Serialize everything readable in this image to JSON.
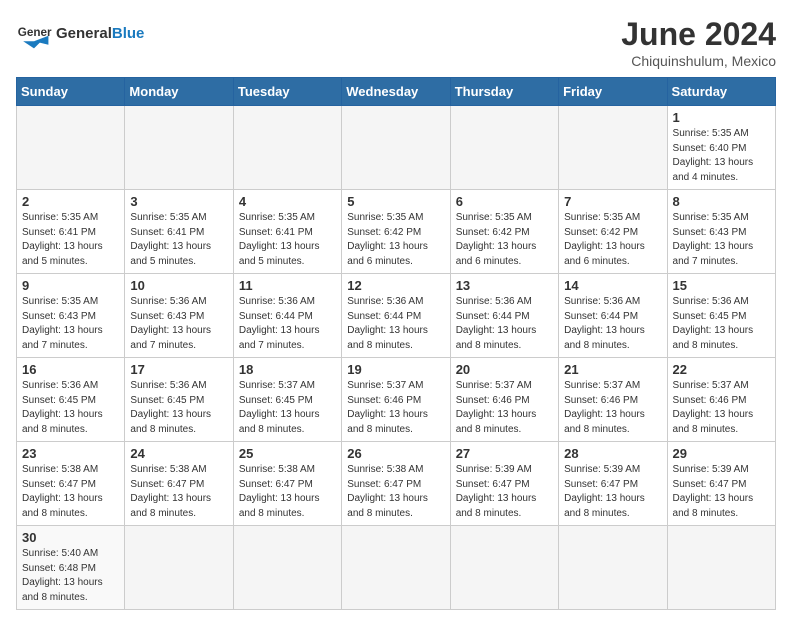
{
  "header": {
    "logo_general": "General",
    "logo_blue": "Blue",
    "month_year": "June 2024",
    "location": "Chiquinshulum, Mexico"
  },
  "days_of_week": [
    "Sunday",
    "Monday",
    "Tuesday",
    "Wednesday",
    "Thursday",
    "Friday",
    "Saturday"
  ],
  "weeks": [
    [
      {
        "day": "",
        "info": ""
      },
      {
        "day": "",
        "info": ""
      },
      {
        "day": "",
        "info": ""
      },
      {
        "day": "",
        "info": ""
      },
      {
        "day": "",
        "info": ""
      },
      {
        "day": "",
        "info": ""
      },
      {
        "day": "1",
        "info": "Sunrise: 5:35 AM\nSunset: 6:40 PM\nDaylight: 13 hours\nand 4 minutes."
      }
    ],
    [
      {
        "day": "2",
        "info": "Sunrise: 5:35 AM\nSunset: 6:41 PM\nDaylight: 13 hours\nand 5 minutes."
      },
      {
        "day": "3",
        "info": "Sunrise: 5:35 AM\nSunset: 6:41 PM\nDaylight: 13 hours\nand 5 minutes."
      },
      {
        "day": "4",
        "info": "Sunrise: 5:35 AM\nSunset: 6:41 PM\nDaylight: 13 hours\nand 5 minutes."
      },
      {
        "day": "5",
        "info": "Sunrise: 5:35 AM\nSunset: 6:42 PM\nDaylight: 13 hours\nand 6 minutes."
      },
      {
        "day": "6",
        "info": "Sunrise: 5:35 AM\nSunset: 6:42 PM\nDaylight: 13 hours\nand 6 minutes."
      },
      {
        "day": "7",
        "info": "Sunrise: 5:35 AM\nSunset: 6:42 PM\nDaylight: 13 hours\nand 6 minutes."
      },
      {
        "day": "8",
        "info": "Sunrise: 5:35 AM\nSunset: 6:43 PM\nDaylight: 13 hours\nand 7 minutes."
      }
    ],
    [
      {
        "day": "9",
        "info": "Sunrise: 5:35 AM\nSunset: 6:43 PM\nDaylight: 13 hours\nand 7 minutes."
      },
      {
        "day": "10",
        "info": "Sunrise: 5:36 AM\nSunset: 6:43 PM\nDaylight: 13 hours\nand 7 minutes."
      },
      {
        "day": "11",
        "info": "Sunrise: 5:36 AM\nSunset: 6:44 PM\nDaylight: 13 hours\nand 7 minutes."
      },
      {
        "day": "12",
        "info": "Sunrise: 5:36 AM\nSunset: 6:44 PM\nDaylight: 13 hours\nand 8 minutes."
      },
      {
        "day": "13",
        "info": "Sunrise: 5:36 AM\nSunset: 6:44 PM\nDaylight: 13 hours\nand 8 minutes."
      },
      {
        "day": "14",
        "info": "Sunrise: 5:36 AM\nSunset: 6:44 PM\nDaylight: 13 hours\nand 8 minutes."
      },
      {
        "day": "15",
        "info": "Sunrise: 5:36 AM\nSunset: 6:45 PM\nDaylight: 13 hours\nand 8 minutes."
      }
    ],
    [
      {
        "day": "16",
        "info": "Sunrise: 5:36 AM\nSunset: 6:45 PM\nDaylight: 13 hours\nand 8 minutes."
      },
      {
        "day": "17",
        "info": "Sunrise: 5:36 AM\nSunset: 6:45 PM\nDaylight: 13 hours\nand 8 minutes."
      },
      {
        "day": "18",
        "info": "Sunrise: 5:37 AM\nSunset: 6:45 PM\nDaylight: 13 hours\nand 8 minutes."
      },
      {
        "day": "19",
        "info": "Sunrise: 5:37 AM\nSunset: 6:46 PM\nDaylight: 13 hours\nand 8 minutes."
      },
      {
        "day": "20",
        "info": "Sunrise: 5:37 AM\nSunset: 6:46 PM\nDaylight: 13 hours\nand 8 minutes."
      },
      {
        "day": "21",
        "info": "Sunrise: 5:37 AM\nSunset: 6:46 PM\nDaylight: 13 hours\nand 8 minutes."
      },
      {
        "day": "22",
        "info": "Sunrise: 5:37 AM\nSunset: 6:46 PM\nDaylight: 13 hours\nand 8 minutes."
      }
    ],
    [
      {
        "day": "23",
        "info": "Sunrise: 5:38 AM\nSunset: 6:47 PM\nDaylight: 13 hours\nand 8 minutes."
      },
      {
        "day": "24",
        "info": "Sunrise: 5:38 AM\nSunset: 6:47 PM\nDaylight: 13 hours\nand 8 minutes."
      },
      {
        "day": "25",
        "info": "Sunrise: 5:38 AM\nSunset: 6:47 PM\nDaylight: 13 hours\nand 8 minutes."
      },
      {
        "day": "26",
        "info": "Sunrise: 5:38 AM\nSunset: 6:47 PM\nDaylight: 13 hours\nand 8 minutes."
      },
      {
        "day": "27",
        "info": "Sunrise: 5:39 AM\nSunset: 6:47 PM\nDaylight: 13 hours\nand 8 minutes."
      },
      {
        "day": "28",
        "info": "Sunrise: 5:39 AM\nSunset: 6:47 PM\nDaylight: 13 hours\nand 8 minutes."
      },
      {
        "day": "29",
        "info": "Sunrise: 5:39 AM\nSunset: 6:47 PM\nDaylight: 13 hours\nand 8 minutes."
      }
    ],
    [
      {
        "day": "30",
        "info": "Sunrise: 5:40 AM\nSunset: 6:48 PM\nDaylight: 13 hours\nand 8 minutes."
      },
      {
        "day": "",
        "info": ""
      },
      {
        "day": "",
        "info": ""
      },
      {
        "day": "",
        "info": ""
      },
      {
        "day": "",
        "info": ""
      },
      {
        "day": "",
        "info": ""
      },
      {
        "day": "",
        "info": ""
      }
    ]
  ]
}
